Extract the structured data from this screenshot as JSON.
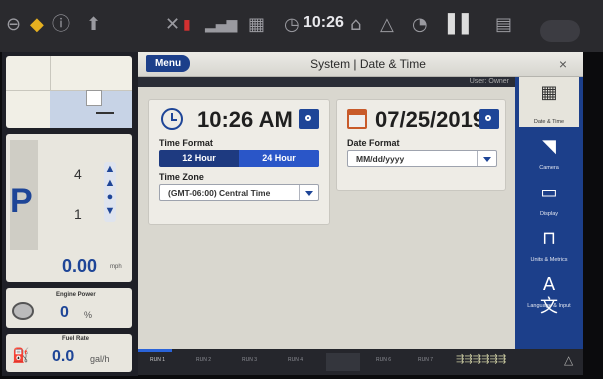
{
  "topbar": {
    "clock": "10:26",
    "icons": [
      "stop-icon",
      "warning-icon",
      "info-icon",
      "upload-arrow-icon",
      "tools-icon",
      "signal-icon",
      "grid-icon",
      "clock-icon",
      "gps-icon",
      "gauge-icon",
      "bars-icon",
      "implement-icon"
    ]
  },
  "left_panel": {
    "gear": "P",
    "forward_gear": "4",
    "reverse_gear": "1",
    "speed": "0.00",
    "speed_unit": "mph",
    "engine_power_label": "Engine Power",
    "engine_power_value": "0",
    "engine_power_unit": "%",
    "fuel_rate_label": "Fuel Rate",
    "fuel_rate_value": "0.0",
    "fuel_rate_unit": "gal/h"
  },
  "window": {
    "menu_label": "Menu",
    "title": "System | Date & Time",
    "close": "×",
    "user_label": "User: Owner"
  },
  "time_card": {
    "time": "10:26 AM",
    "time_format_label": "Time Format",
    "format_12": "12 Hour",
    "format_24": "24 Hour",
    "selected_format": "24 Hour",
    "time_zone_label": "Time Zone",
    "time_zone_value": "(GMT-06:00) Central Time"
  },
  "date_card": {
    "date": "07/25/2019",
    "date_format_label": "Date Format",
    "date_format_value": "MM/dd/yyyy"
  },
  "right_nav": [
    {
      "label": "Date & Time",
      "icon": "calendar-clock-icon"
    },
    {
      "label": "Camera",
      "icon": "camera-icon"
    },
    {
      "label": "Display",
      "icon": "monitor-icon"
    },
    {
      "label": "Units & Metrics",
      "icon": "units-icon"
    },
    {
      "label": "Language & Input",
      "icon": "language-icon"
    }
  ],
  "bottom_bar": {
    "runs": [
      "RUN 1",
      "RUN 2",
      "RUN 3",
      "RUN 4",
      "",
      "RUN 6",
      "RUN 7"
    ]
  },
  "colors": {
    "accent_blue": "#1e4597",
    "nav_blue": "#1c3f8a",
    "panel_bg": "#dcdad2"
  }
}
